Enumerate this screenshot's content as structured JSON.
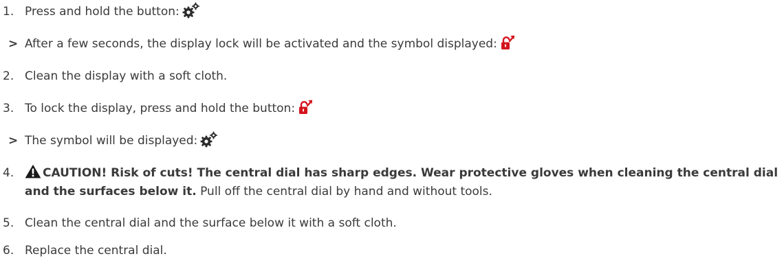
{
  "steps": [
    {
      "number": "1.",
      "text": "Press and hold the button:",
      "icon": "gears-icon"
    },
    {
      "marker": ">",
      "text": "After a few seconds, the display lock will be activated and the symbol displayed:",
      "icon": "unlock-icon"
    },
    {
      "number": "2.",
      "text": "Clean the display with a soft cloth."
    },
    {
      "number": "3.",
      "text": "To lock the display, press and hold the button:",
      "icon": "unlock-icon"
    },
    {
      "marker": ">",
      "text": "The symbol will be displayed:",
      "icon": "gears-icon"
    },
    {
      "number": "4.",
      "warning_icon": "warning-triangle-icon",
      "warning_text": "CAUTION! Risk of cuts! The central dial has sharp edges. Wear protective gloves when cleaning the central dial and the surfaces below it.",
      "text": " Pull off the central dial by hand and without tools."
    },
    {
      "number": "5.",
      "text": "Clean the central dial and the surface below it with a soft cloth."
    },
    {
      "number": "6.",
      "text": "Replace the central dial."
    }
  ],
  "colors": {
    "text": "#3a3a3a",
    "icon_dark": "#2b2b2b",
    "accent_red": "#d4141e"
  }
}
